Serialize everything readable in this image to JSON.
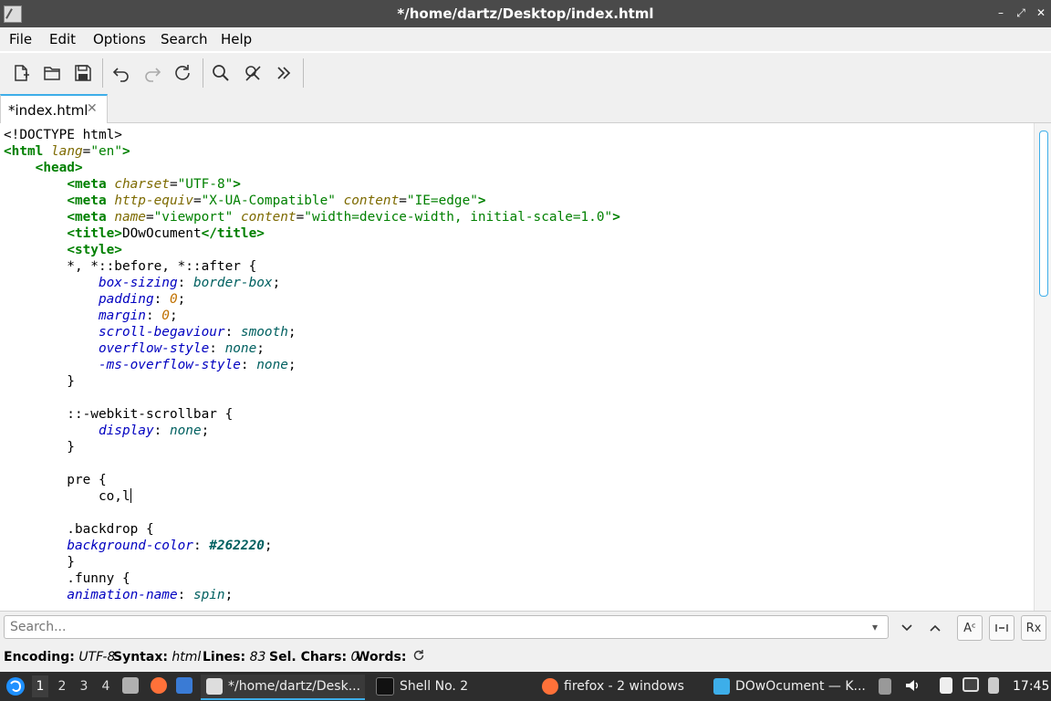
{
  "window": {
    "title": "*/home/dartz/Desktop/index.html",
    "controls": [
      "–",
      "⤢",
      "✕"
    ]
  },
  "menu": {
    "items": [
      "File",
      "Edit",
      "Options",
      "Search",
      "Help"
    ]
  },
  "toolbar": {
    "icons": [
      "new-file-icon",
      "open-folder-icon",
      "save-icon",
      "undo-icon",
      "redo-icon",
      "reload-icon",
      "find-icon",
      "find-replace-icon",
      "more-icon"
    ]
  },
  "tabs": [
    {
      "label": "*index.html",
      "close": "✕"
    }
  ],
  "editor": {
    "lines": [
      "<!DOCTYPE html>",
      "<html lang=\"en\">",
      "    <head>",
      "        <meta charset=\"UTF-8\">",
      "        <meta http-equiv=\"X-UA-Compatible\" content=\"IE=edge\">",
      "        <meta name=\"viewport\" content=\"width=device-width, initial-scale=1.0\">",
      "        <title>DOwOcument</title>",
      "        <style>",
      "        *, *::before, *::after {",
      "            box-sizing: border-box;",
      "            padding: 0;",
      "            margin: 0;",
      "            scroll-begaviour: smooth;",
      "            overflow-style: none;",
      "            -ms-overflow-style: none;",
      "        }",
      "",
      "        ::-webkit-scrollbar {",
      "            display: none;",
      "        }",
      "",
      "        pre {",
      "            co,l",
      "",
      "        .backdrop {",
      "        background-color: #262220;",
      "        }",
      "        .funny {",
      "        animation-name: spin;"
    ]
  },
  "search": {
    "placeholder": "Search...",
    "buttons": [
      "chevron-down-icon",
      "chevron-up-icon",
      "match-case-icon",
      "whole-word-icon",
      "regex-icon"
    ],
    "regex_label": "Rx"
  },
  "status": {
    "encoding_label": "Encoding:",
    "encoding_value": "UTF-8",
    "syntax_label": "Syntax:",
    "syntax_value": "html",
    "lines_label": "Lines:",
    "lines_value": "83",
    "selchars_label": "Sel. Chars:",
    "selchars_value": "0",
    "words_label": "Words:"
  },
  "taskbar": {
    "workspaces": [
      "1",
      "2",
      "3",
      "4"
    ],
    "active_workspace": "1",
    "tasks": [
      {
        "label": "*/home/dartz/Desk...",
        "active": true
      },
      {
        "label": "Shell No. 2",
        "active": false
      },
      {
        "label": "firefox - 2 windows",
        "active": false
      },
      {
        "label": "DOwOcument — K...",
        "active": false
      }
    ],
    "clock": "17:45"
  },
  "colors": {
    "accent": "#3daee9",
    "titlebar": "#4a4a4a",
    "taskbar": "#2d2d2d",
    "tag": "#008000",
    "attribute": "#7d6a00",
    "property": "#0000c0",
    "value": "#006060"
  }
}
